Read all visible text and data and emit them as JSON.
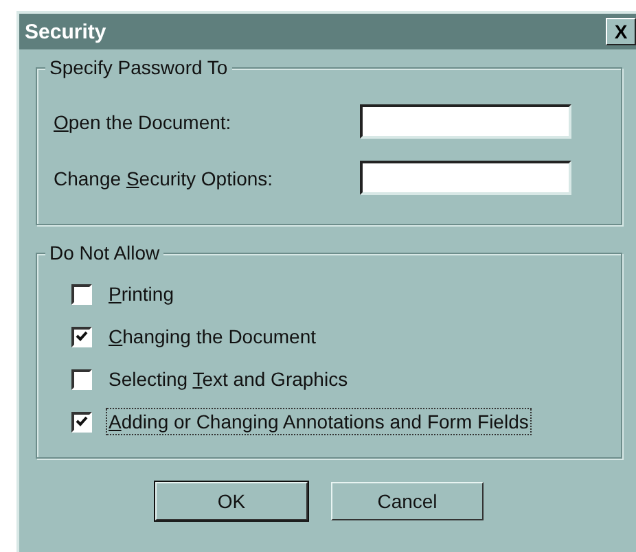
{
  "window": {
    "title": "Security",
    "close": "X"
  },
  "password_group": {
    "title": "Specify Password To",
    "fields": [
      {
        "access_key": "O",
        "label_end": "pen the Document:"
      },
      {
        "label_start": "Change ",
        "access_key": "S",
        "label_end": "ecurity Options:"
      }
    ]
  },
  "restrictions_group": {
    "title": "Do Not Allow",
    "options": [
      {
        "access_key": "P",
        "label_end": "rinting",
        "checked": false,
        "focused": false
      },
      {
        "access_key": "C",
        "label_end": "hanging the Document",
        "checked": true,
        "focused": false
      },
      {
        "label_start": "Selecting ",
        "access_key": "T",
        "label_end": "ext and Graphics",
        "checked": false,
        "focused": false
      },
      {
        "access_key": "A",
        "label_end": "dding or Changing Annotations and Form Fields",
        "checked": true,
        "focused": true
      }
    ]
  },
  "buttons": [
    {
      "label": "OK",
      "default": true
    },
    {
      "label": "Cancel",
      "default": false
    }
  ]
}
